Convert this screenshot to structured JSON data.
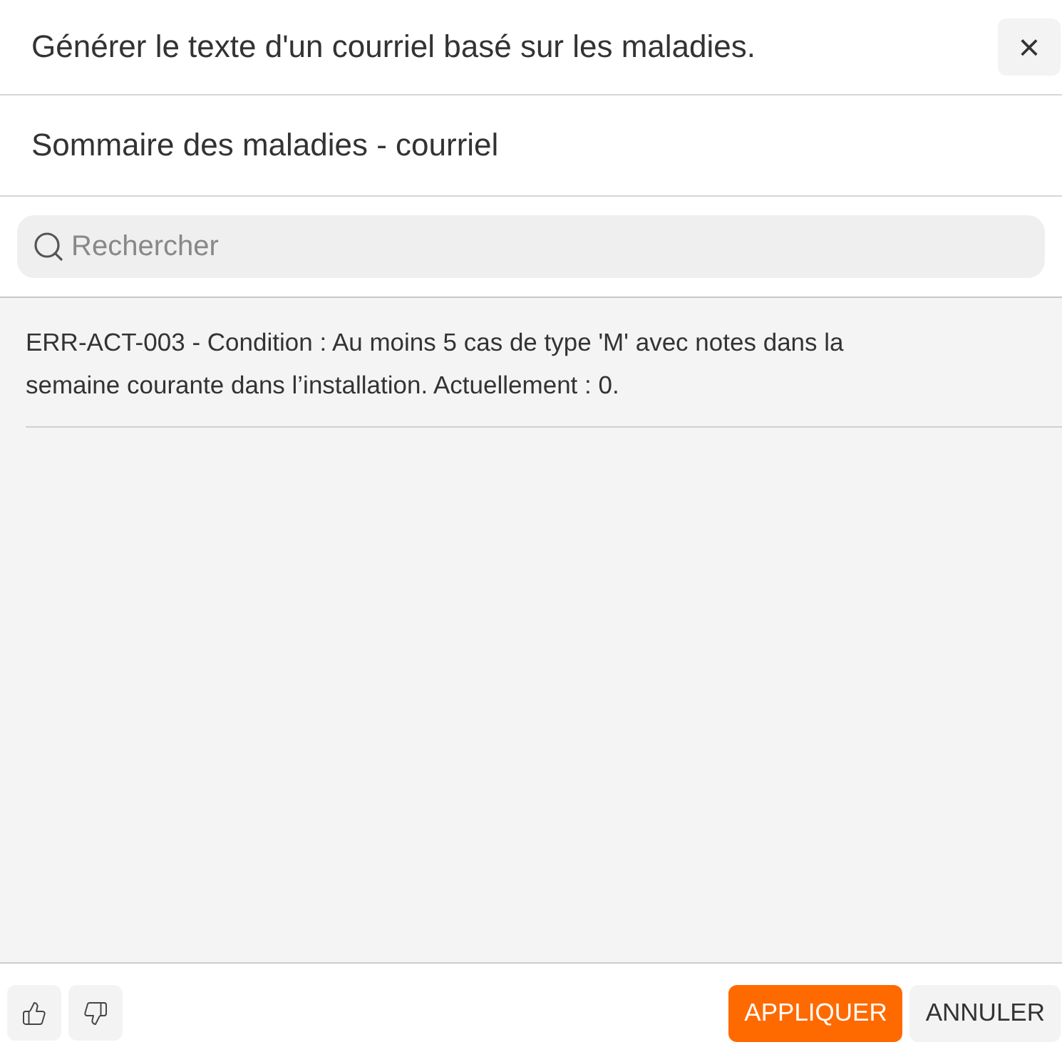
{
  "dialog": {
    "title": "Générer le texte d'un courriel basé sur les maladies.",
    "close_label": "×"
  },
  "subtitle": "Sommaire des maladies - courriel",
  "search": {
    "placeholder": "Rechercher"
  },
  "items": [
    {
      "text": "ERR-ACT-003 - Condition : Au moins 5 cas de type 'M' avec notes dans la semaine courante dans l’installation. Actuellement : 0."
    }
  ],
  "buttons": [
    {
      "label": "APPLIQUER",
      "kind": "primary"
    },
    {
      "label": "ANNULER",
      "kind": "secondary"
    }
  ]
}
